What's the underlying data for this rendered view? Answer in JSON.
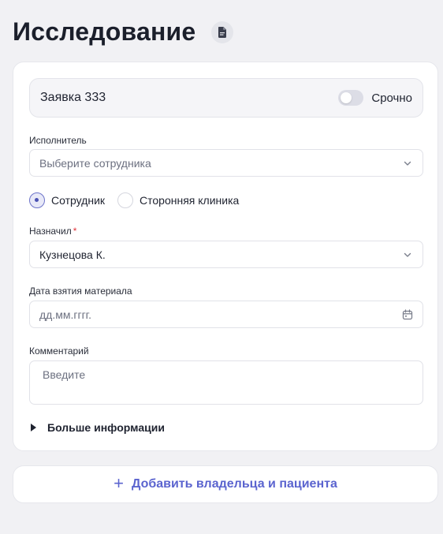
{
  "header": {
    "title": "Исследование",
    "doc_icon": "document-icon"
  },
  "request": {
    "title": "Заявка 333",
    "urgent_label": "Срочно",
    "urgent_on": false
  },
  "executor": {
    "label": "Исполнитель",
    "placeholder": "Выберите сотрудника"
  },
  "source": {
    "options": [
      {
        "label": "Сотрудник",
        "checked": true
      },
      {
        "label": "Сторонняя клиника",
        "checked": false
      }
    ]
  },
  "assigned": {
    "label": "Назначил",
    "required_mark": "*",
    "value": "Кузнецова К."
  },
  "sample_date": {
    "label": "Дата взятия материала",
    "placeholder": "дд.мм.гггг."
  },
  "comment": {
    "label": "Комментарий",
    "placeholder": "Введите"
  },
  "more": {
    "label": "Больше информации"
  },
  "add": {
    "plus": "+",
    "label": "Добавить владельца и пациента"
  },
  "colors": {
    "accent": "#5b64cf",
    "background": "#f1f1f4",
    "required": "#e0343a"
  }
}
